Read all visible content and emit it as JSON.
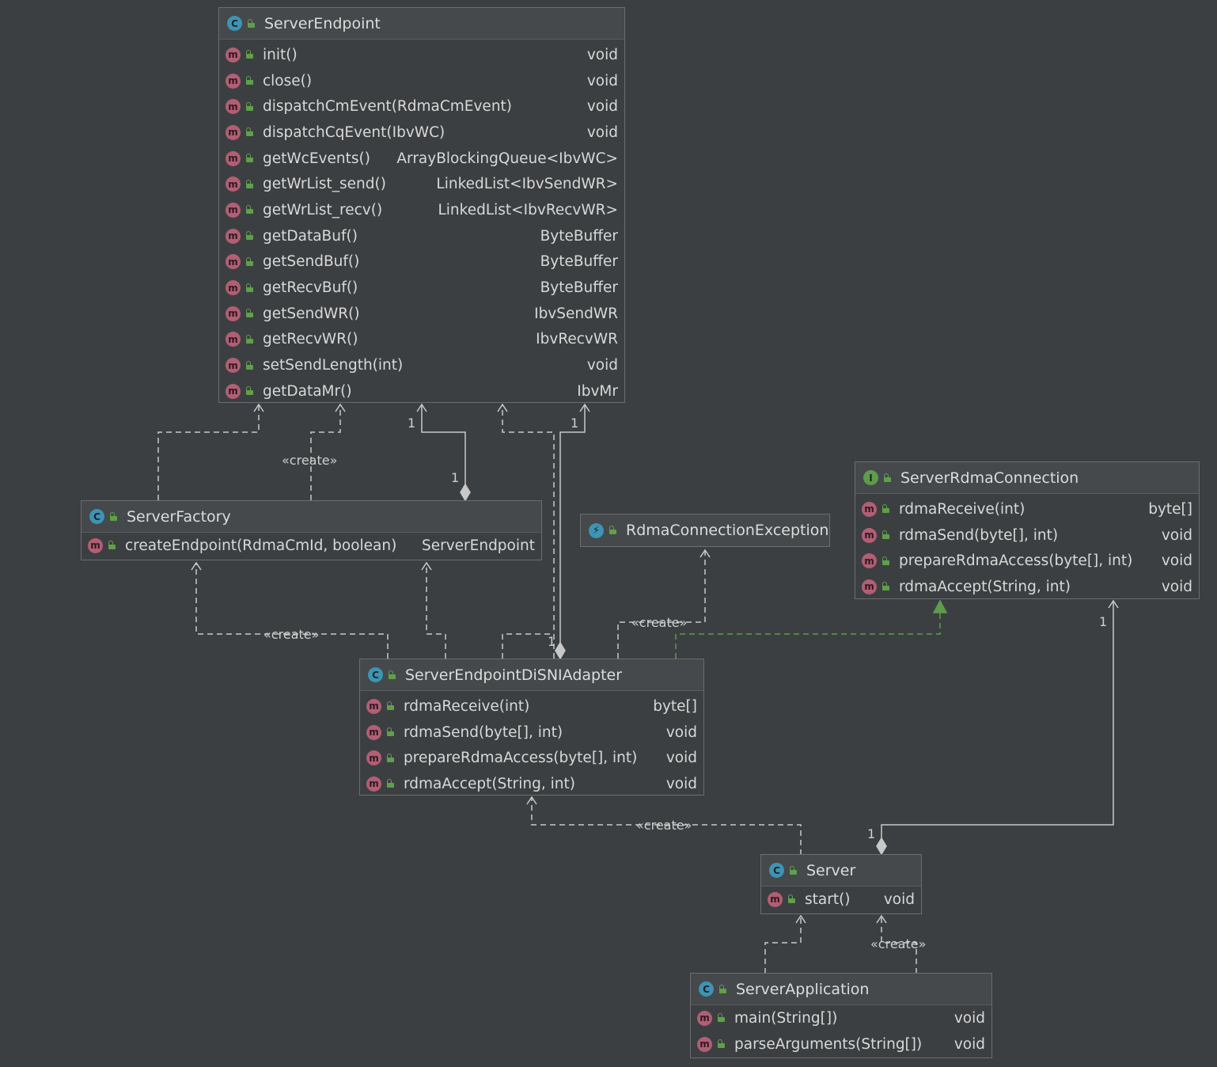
{
  "diagram": {
    "nodes": {
      "server_endpoint": {
        "title": "ServerEndpoint",
        "kind_icon": "C",
        "methods": [
          {
            "name": "init()",
            "type": "void"
          },
          {
            "name": "close()",
            "type": "void"
          },
          {
            "name": "dispatchCmEvent(RdmaCmEvent)",
            "type": "void"
          },
          {
            "name": "dispatchCqEvent(IbvWC)",
            "type": "void"
          },
          {
            "name": "getWcEvents()",
            "type": "ArrayBlockingQueue<IbvWC>"
          },
          {
            "name": "getWrList_send()",
            "type": "LinkedList<IbvSendWR>"
          },
          {
            "name": "getWrList_recv()",
            "type": "LinkedList<IbvRecvWR>"
          },
          {
            "name": "getDataBuf()",
            "type": "ByteBuffer"
          },
          {
            "name": "getSendBuf()",
            "type": "ByteBuffer"
          },
          {
            "name": "getRecvBuf()",
            "type": "ByteBuffer"
          },
          {
            "name": "getSendWR()",
            "type": "IbvSendWR"
          },
          {
            "name": "getRecvWR()",
            "type": "IbvRecvWR"
          },
          {
            "name": "setSendLength(int)",
            "type": "void"
          },
          {
            "name": "getDataMr()",
            "type": "IbvMr"
          }
        ]
      },
      "server_factory": {
        "title": "ServerFactory",
        "kind_icon": "C",
        "methods": [
          {
            "name": "createEndpoint(RdmaCmId, boolean)",
            "type": "ServerEndpoint"
          }
        ]
      },
      "rdma_connection_exception": {
        "title": "RdmaConnectionException",
        "kind_icon": "⚡"
      },
      "server_rdma_connection": {
        "title": "ServerRdmaConnection",
        "kind_icon": "I",
        "methods": [
          {
            "name": "rdmaReceive(int)",
            "type": "byte[]"
          },
          {
            "name": "rdmaSend(byte[], int)",
            "type": "void"
          },
          {
            "name": "prepareRdmaAccess(byte[], int)",
            "type": "void"
          },
          {
            "name": "rdmaAccept(String, int)",
            "type": "void"
          }
        ]
      },
      "adapter": {
        "title": "ServerEndpointDiSNIAdapter",
        "kind_icon": "C",
        "methods": [
          {
            "name": "rdmaReceive(int)",
            "type": "byte[]"
          },
          {
            "name": "rdmaSend(byte[], int)",
            "type": "void"
          },
          {
            "name": "prepareRdmaAccess(byte[], int)",
            "type": "void"
          },
          {
            "name": "rdmaAccept(String, int)",
            "type": "void"
          }
        ]
      },
      "server": {
        "title": "Server",
        "kind_icon": "C",
        "methods": [
          {
            "name": "start()",
            "type": "void"
          }
        ]
      },
      "server_application": {
        "title": "ServerApplication",
        "kind_icon": "C",
        "methods": [
          {
            "name": "main(String[])",
            "type": "void"
          },
          {
            "name": "parseArguments(String[])",
            "type": "void"
          }
        ]
      }
    },
    "method_icon": "m",
    "edge_labels": {
      "create_factory_endpoint": "«create»",
      "create_adapter_factory": "«create»",
      "create_adapter_exception": "«create»",
      "create_server_adapter": "«create»",
      "create_app_server": "«create»"
    },
    "multiplicities": {
      "factory_endpoint_top": "1",
      "factory_endpoint_bottom": "1",
      "adapter_endpoint_top": "1",
      "adapter_endpoint_bottom": "1",
      "server_connection_top": "1",
      "server_connection_bottom": "1"
    },
    "colors": {
      "background": "#3c3f41",
      "edge": "#c8c8c8",
      "implements_edge": "#5e9c4a",
      "class_icon": "#3d94b4",
      "interface_icon": "#5e9c4a",
      "method_icon": "#b25e74"
    }
  }
}
